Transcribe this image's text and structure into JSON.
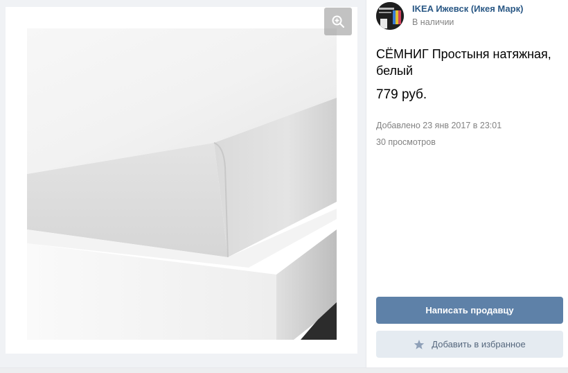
{
  "seller": {
    "name": "IKEA Ижевск (Икея Марк)",
    "status": "В наличии"
  },
  "product": {
    "title": "СЁМНИГ Простыня натяжная, белый",
    "price": "779 руб.",
    "added": "Добавлено 23 янв 2017 в 23:01",
    "views": "30 просмотров"
  },
  "actions": {
    "contact_label": "Написать продавцу",
    "favorite_label": "Добавить в избранное"
  },
  "icons": {
    "zoom": "zoom-in-icon",
    "favorite": "star-icon"
  },
  "colors": {
    "link": "#2a5885",
    "primary_button": "#5e81a8",
    "secondary_button": "#e5ebf1",
    "muted_text": "#828282"
  }
}
